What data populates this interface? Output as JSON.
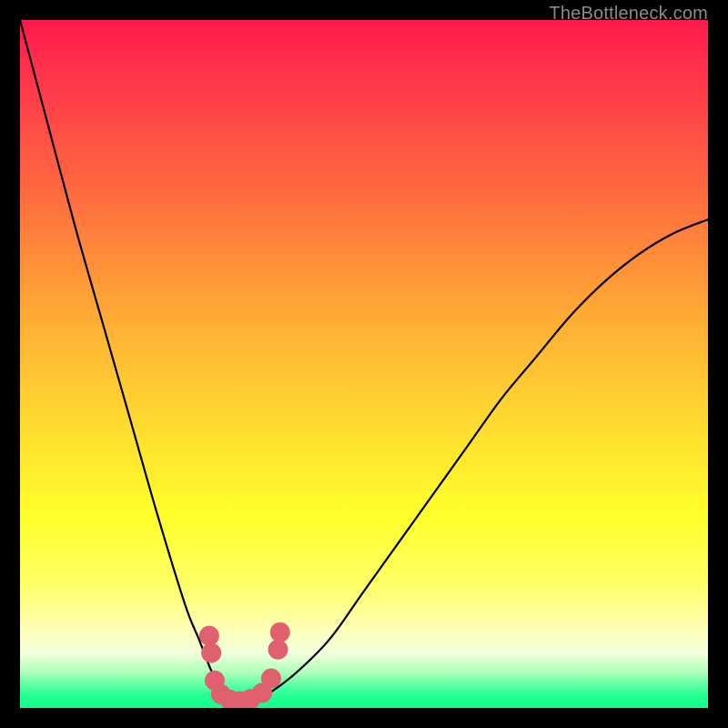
{
  "watermark": "TheBottleneck.com",
  "chart_data": {
    "type": "line",
    "title": "",
    "xlabel": "",
    "ylabel": "",
    "xlim": [
      0,
      100
    ],
    "ylim": [
      0,
      100
    ],
    "series": [
      {
        "name": "bottleneck-curve",
        "x": [
          0,
          4,
          8,
          12,
          16,
          20,
          24,
          26,
          28,
          30,
          32,
          34,
          36,
          40,
          45,
          50,
          55,
          60,
          65,
          70,
          75,
          80,
          85,
          90,
          95,
          100
        ],
        "y": [
          100,
          85,
          70,
          56,
          42,
          28,
          15,
          10,
          5,
          2,
          1,
          1,
          2,
          5,
          10,
          17,
          24,
          31,
          38,
          45,
          51,
          57,
          62,
          66,
          69,
          71
        ]
      }
    ],
    "marker_cluster": {
      "name": "trough-markers",
      "color": "#e06070",
      "points": [
        {
          "x": 27.5,
          "y": 10.5
        },
        {
          "x": 27.8,
          "y": 8.0
        },
        {
          "x": 28.3,
          "y": 4.0
        },
        {
          "x": 29.2,
          "y": 2.0
        },
        {
          "x": 30.5,
          "y": 1.2
        },
        {
          "x": 32.0,
          "y": 1.0
        },
        {
          "x": 33.5,
          "y": 1.3
        },
        {
          "x": 35.2,
          "y": 2.2
        },
        {
          "x": 36.5,
          "y": 4.3
        },
        {
          "x": 37.5,
          "y": 8.5
        },
        {
          "x": 37.8,
          "y": 11.0
        }
      ]
    }
  }
}
